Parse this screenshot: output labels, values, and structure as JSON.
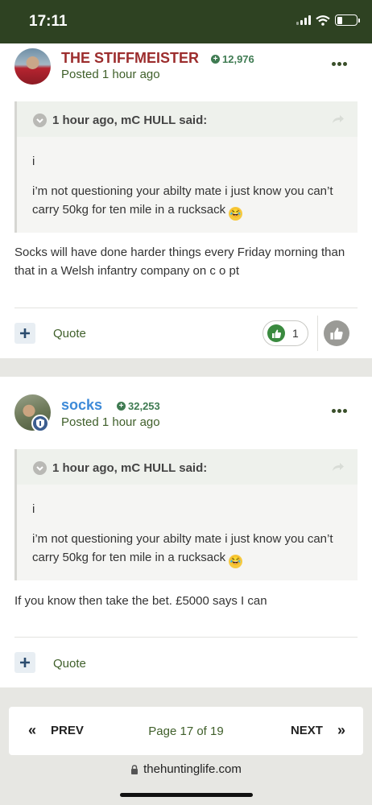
{
  "status_bar": {
    "time": "17:11"
  },
  "posts": [
    {
      "author": "THE STIFFMEISTER",
      "reputation": "12,976",
      "posted": "Posted 1 hour ago",
      "quote": {
        "header": "1 hour ago, mC HULL said:",
        "line1": "i",
        "line2": "i’m not questioning your abilty mate i just know you can’t carry 50kg for ten mile in a rucksack",
        "emoji": "😂"
      },
      "body": "Socks will have done harder things every Friday morning than that in a Welsh infantry company on c o pt",
      "quote_label": "Quote",
      "likes": "1"
    },
    {
      "author": "socks",
      "reputation": "32,253",
      "posted": "Posted 1 hour ago",
      "quote": {
        "header": "1 hour ago, mC HULL said:",
        "line1": "i",
        "line2": "i’m not questioning your abilty mate i just know you can’t carry 50kg for ten mile in a rucksack",
        "emoji": "😂"
      },
      "body": "If you know then take the bet. £5000 says I can",
      "quote_label": "Quote"
    }
  ],
  "pagination": {
    "prev": "PREV",
    "page_info": "Page 17 of 19",
    "next": "NEXT"
  },
  "browser": {
    "url": "thehuntinglife.com"
  },
  "colors": {
    "header_bg": "#2e4222",
    "author1": "#9c2d2d",
    "author2": "#3d8ad8",
    "accent_green": "#3f5f2a",
    "reputation": "#3f7b52"
  }
}
